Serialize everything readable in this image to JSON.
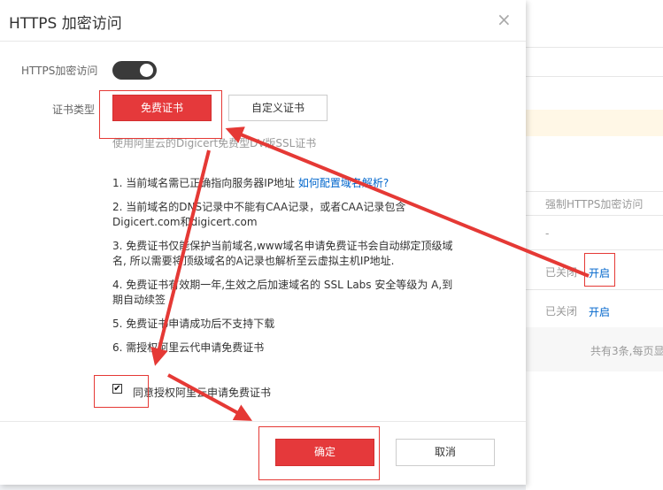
{
  "background": {
    "column_header": "强制HTTPS加密访问",
    "row1_value": "-",
    "row2_status": "已关闭",
    "row2_action": "开启",
    "row3_status": "已关闭",
    "row3_action": "开启",
    "pagination": "共有3条,每页显"
  },
  "dialog": {
    "title": "HTTPS 加密访问",
    "close_glyph": "×",
    "https_label": "HTTPS加密访问",
    "https_toggle_on": true,
    "cert_type_label": "证书类型",
    "free_cert_button": "免费证书",
    "custom_cert_button": "自定义证书",
    "description": "使用阿里云的Digicert免费型DV版SSL证书",
    "notes": [
      {
        "text": "1. 当前域名需已正确指向服务器IP地址 ",
        "link": "如何配置域名解析?"
      },
      {
        "text": "2. 当前域名的DNS记录中不能有CAA记录，或者CAA记录包含Digicert.com和digicert.com",
        "link": ""
      },
      {
        "text": "3. 免费证书仅能保护当前域名,www域名申请免费证书会自动绑定顶级域名, 所以需要将顶级域名的A记录也解析至云虚拟主机IP地址.",
        "link": ""
      },
      {
        "text": "4. 免费证书有效期一年,生效之后加速域名的 SSL Labs 安全等级为 A,到期自动续签",
        "link": ""
      },
      {
        "text": "5. 免费证书申请成功后不支持下载",
        "link": ""
      },
      {
        "text": "6. 需授权阿里云代申请免费证书",
        "link": ""
      }
    ],
    "agree_checked": true,
    "checkbox_glyph": "✔",
    "agree_label": "同意授权阿里云申请免费证书",
    "confirm_button": "确定",
    "cancel_button": "取消"
  },
  "colors": {
    "accent_red": "#e5393b",
    "link_blue": "#0066cc",
    "annotation_red": "#e53935"
  }
}
